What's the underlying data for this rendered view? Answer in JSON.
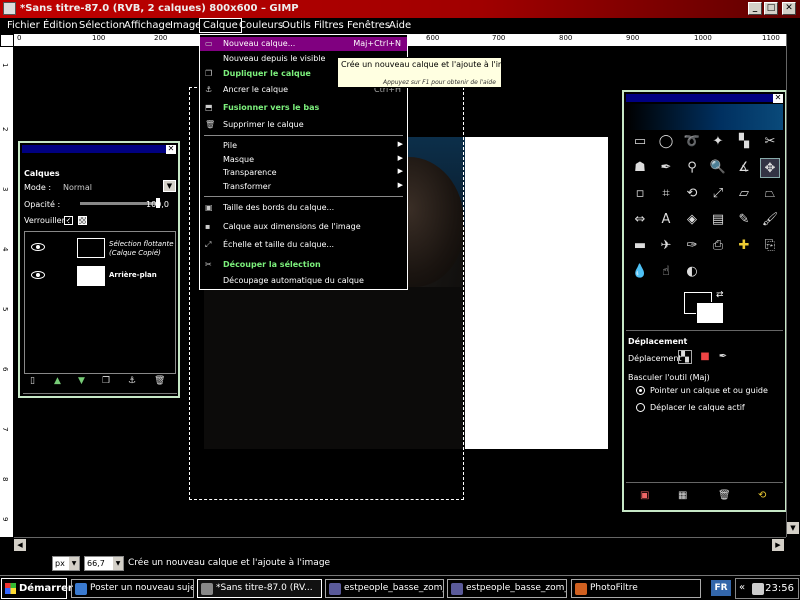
{
  "window": {
    "title": "*Sans titre-87.0 (RVB, 2 calques) 800x600 – GIMP",
    "buttons": {
      "minimize": "_",
      "maximize": "□",
      "close": "✕"
    }
  },
  "menubar": {
    "items": [
      "Fichier",
      "Édition",
      "Sélection",
      "Affichage",
      "Image",
      "Calque",
      "Couleurs",
      "Outils",
      "Filtres",
      "Fenêtres",
      "Aide"
    ]
  },
  "ruler": {
    "top_ticks": [
      "0",
      "100",
      "200",
      "300",
      "400",
      "500",
      "600",
      "700",
      "800",
      "900",
      "1000",
      "1100"
    ],
    "left_ticks": [
      "1",
      "2",
      "3",
      "4",
      "5",
      "6",
      "7",
      "8",
      "9"
    ]
  },
  "calque_menu": {
    "items": [
      {
        "label": "Nouveau calque...",
        "shortcut": "Maj+Ctrl+N",
        "icon": "new-layer-icon",
        "highlighted": true,
        "green": false
      },
      {
        "label": "Nouveau depuis le visible",
        "shortcut": "",
        "icon": "",
        "highlighted": false,
        "green": false
      },
      {
        "label": "Dupliquer le calque",
        "shortcut": "",
        "icon": "duplicate-icon",
        "highlighted": false,
        "green": true
      },
      {
        "label": "Ancrer le calque",
        "shortcut": "Ctrl+H",
        "icon": "anchor-icon",
        "highlighted": false,
        "green": false
      },
      {
        "label": "Fusionner vers le bas",
        "shortcut": "",
        "icon": "merge-icon",
        "highlighted": false,
        "green": true
      },
      {
        "label": "Supprimer le calque",
        "shortcut": "",
        "icon": "trash-icon",
        "highlighted": false,
        "green": false
      }
    ],
    "submenus": [
      "Pile",
      "Masque",
      "Transparence",
      "Transformer"
    ],
    "items2": [
      {
        "label": "Taille des bords du calque...",
        "icon": "layer-size-icon",
        "green": false
      },
      {
        "label": "Calque aux dimensions de l'image",
        "icon": "layer-to-image-icon",
        "green": false
      },
      {
        "label": "Échelle et taille du calque...",
        "icon": "scale-icon",
        "green": false
      },
      {
        "label": "Découper la sélection",
        "icon": "crop-icon",
        "green": true
      },
      {
        "label": "Découpage automatique du calque",
        "icon": "",
        "green": false
      }
    ]
  },
  "tooltip": {
    "text": "Crée un nouveau calque et l'ajoute à l'image",
    "hint": "Appuyez sur F1 pour obtenir de l'aide"
  },
  "layers_panel": {
    "title": "Calques",
    "mode_label": "Mode :",
    "mode_value": "Normal",
    "opacity_label": "Opacité :",
    "opacity_value": "100,0",
    "opacity_level": 1.0,
    "lock_label": "Verrouiller :",
    "layers": [
      {
        "name": "Sélection flottante",
        "subname": "(Calque Copié)",
        "thumb": "dark"
      },
      {
        "name": "Arrière-plan",
        "subname": "",
        "thumb": "white"
      }
    ]
  },
  "toolbox": {
    "section_title": "Déplacement",
    "move_label": "Déplacement :",
    "toggle_label": "Basculer l'outil (Maj)",
    "radio_options": [
      {
        "label": "Pointer un calque et ou guide",
        "checked": true
      },
      {
        "label": "Déplacer le calque actif",
        "checked": false
      }
    ]
  },
  "statusbar": {
    "unit": "px",
    "zoom": "66,7",
    "message": "Crée un nouveau calque et l'ajoute à l'image"
  },
  "taskbar": {
    "start_label": "Démarrer",
    "tasks": [
      {
        "label": "Poster un nouveau sujet ...",
        "color": "#3a7ad0"
      },
      {
        "label": "*Sans titre-87.0 (RV...",
        "color": "#888888"
      },
      {
        "label": "estpeople_basse_zom_3...",
        "color": "#5a5a9a"
      },
      {
        "label": "estpeople_basse_zom_3...",
        "color": "#5a5a9a"
      },
      {
        "label": "PhotoFiltre",
        "color": "#d06020"
      }
    ],
    "lang": "FR",
    "chevron": "«",
    "clock": "23:56"
  }
}
